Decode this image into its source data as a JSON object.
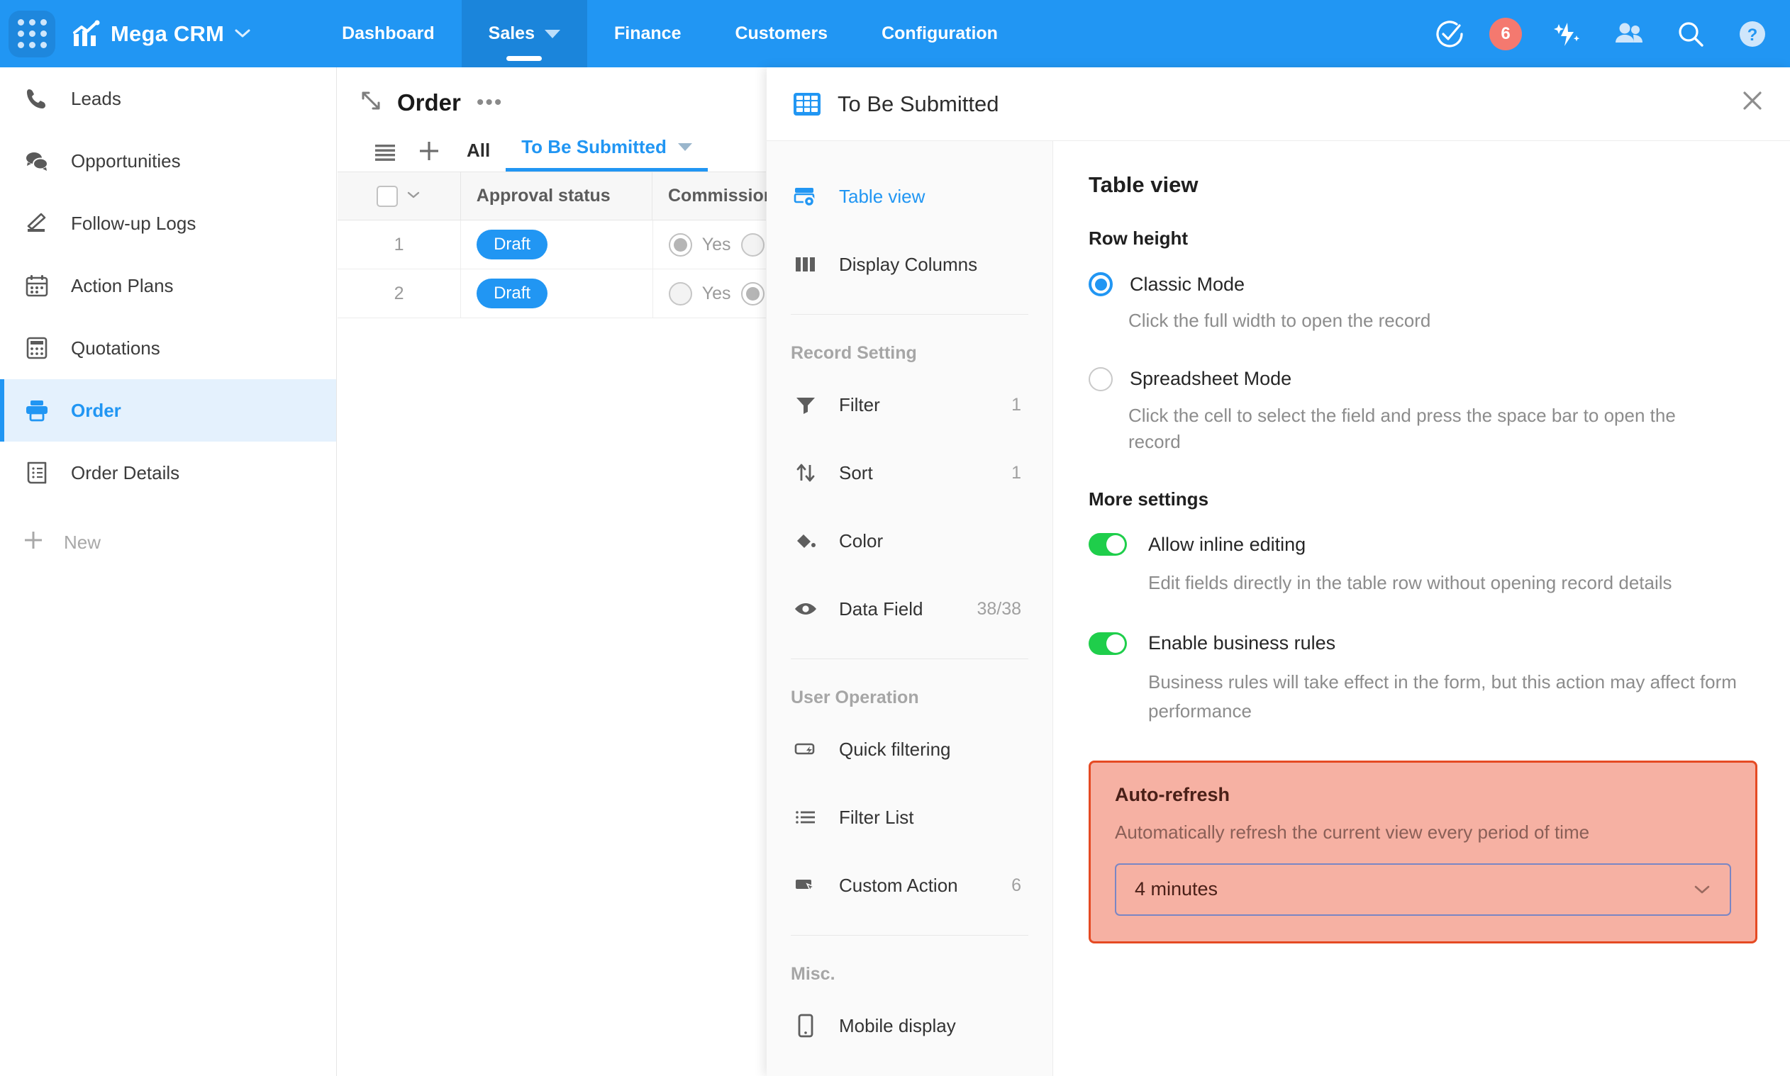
{
  "topbar": {
    "apps_icon": "grid-apps-icon",
    "brand": "Mega CRM",
    "brand_icon": "chart-bars-icon",
    "brand_caret": "⌄",
    "tabs": [
      {
        "label": "Dashboard",
        "active": false,
        "has_caret": false
      },
      {
        "label": "Sales",
        "active": true,
        "has_caret": true
      },
      {
        "label": "Finance",
        "active": false,
        "has_caret": false
      },
      {
        "label": "Customers",
        "active": false,
        "has_caret": false
      },
      {
        "label": "Configuration",
        "active": false,
        "has_caret": false
      }
    ],
    "tasks_badge": "6",
    "icons": [
      "check-circle-icon",
      "ai-sparkle-icon",
      "people-icon",
      "search-icon",
      "help-icon"
    ]
  },
  "sidebar": {
    "items": [
      {
        "label": "Leads",
        "icon": "phone-icon",
        "active": false
      },
      {
        "label": "Opportunities",
        "icon": "chat-bubbles-icon",
        "active": false
      },
      {
        "label": "Follow-up Logs",
        "icon": "pen-edit-icon",
        "active": false
      },
      {
        "label": "Action Plans",
        "icon": "calendar-icon",
        "active": false
      },
      {
        "label": "Quotations",
        "icon": "calculator-icon",
        "active": false
      },
      {
        "label": "Order",
        "icon": "printer-icon",
        "active": true
      },
      {
        "label": "Order Details",
        "icon": "document-list-icon",
        "active": false
      }
    ],
    "new_label": "New",
    "new_icon": "plus-icon"
  },
  "table": {
    "title": "Order",
    "collapse_icon": "collapse-arrow-icon",
    "more_icon": "ellipsis-icon",
    "toolbar_icons": [
      "list-menu-icon",
      "plus-icon"
    ],
    "tabs": [
      {
        "label": "All",
        "active": false
      },
      {
        "label": "To Be Submitted",
        "active": true
      }
    ],
    "columns": [
      "",
      "Approval status",
      "Commission"
    ],
    "rows": [
      {
        "num": "1",
        "approval_status": "Draft",
        "commission_radio": "filled",
        "commission_label": "Yes"
      },
      {
        "num": "2",
        "approval_status": "Draft",
        "commission_radio": "empty",
        "commission_label": "Yes"
      }
    ]
  },
  "panel": {
    "icon": "grid-table-icon",
    "title": "To Be Submitted",
    "close_icon": "close-icon",
    "nav": [
      {
        "label": "Table view",
        "icon": "table-view-icon",
        "active": true,
        "count": ""
      },
      {
        "label": "Display Columns",
        "icon": "columns-icon",
        "active": false,
        "count": ""
      }
    ],
    "group_record_setting": "Record Setting",
    "nav_record": [
      {
        "label": "Filter",
        "icon": "funnel-icon",
        "count": "1"
      },
      {
        "label": "Sort",
        "icon": "sort-arrows-icon",
        "count": "1"
      },
      {
        "label": "Color",
        "icon": "paint-bucket-icon",
        "count": ""
      },
      {
        "label": "Data Field",
        "icon": "eye-icon",
        "count": "38/38"
      }
    ],
    "group_user_operation": "User Operation",
    "nav_user": [
      {
        "label": "Quick filtering",
        "icon": "quick-filter-icon",
        "count": ""
      },
      {
        "label": "Filter List",
        "icon": "list-lines-icon",
        "count": ""
      },
      {
        "label": "Custom Action",
        "icon": "cursor-action-icon",
        "count": "6"
      }
    ],
    "group_misc": "Misc.",
    "nav_misc": [
      {
        "label": "Mobile display",
        "icon": "mobile-phone-icon",
        "count": ""
      }
    ]
  },
  "settings": {
    "heading": "Table view",
    "row_height_label": "Row height",
    "modes": [
      {
        "label": "Classic Mode",
        "desc": "Click the full width to open the record",
        "selected": true
      },
      {
        "label": "Spreadsheet Mode",
        "desc": "Click the cell to select the field and press the space bar to open the record",
        "selected": false
      }
    ],
    "more_settings_label": "More settings",
    "toggles": [
      {
        "label": "Allow inline editing",
        "desc": "Edit fields directly in the table row without opening record details",
        "on": true
      },
      {
        "label": "Enable business rules",
        "desc": "Business rules will take effect in the form, but this action may affect form performance",
        "on": true
      }
    ],
    "auto_refresh": {
      "title": "Auto-refresh",
      "desc": "Automatically refresh the current view every period of time",
      "value": "4 minutes",
      "caret": "⌄",
      "highlight_fill": "#f6b1a3",
      "highlight_border": "#e54a23"
    }
  },
  "colors": {
    "brand_blue": "#2196f3",
    "nav_active_blue": "#1b85db",
    "toggle_green": "#1fce4b",
    "badge_red": "#f4796f"
  }
}
